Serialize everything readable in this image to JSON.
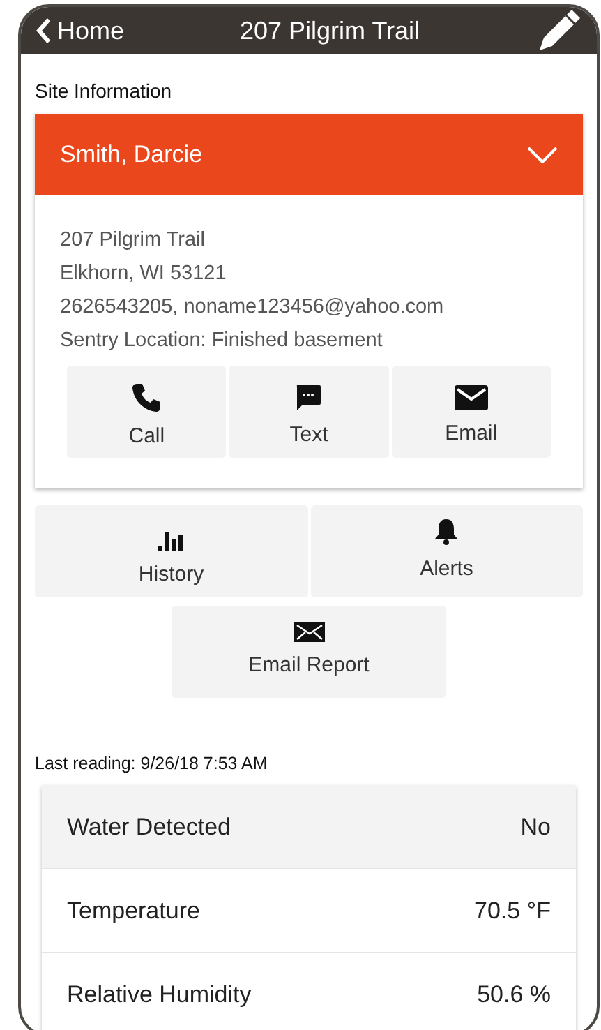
{
  "header": {
    "back_label": "Home",
    "title": "207 Pilgrim Trail"
  },
  "section_label": "Site Information",
  "contact": {
    "name": "Smith, Darcie",
    "expanded": true,
    "lines": [
      "207 Pilgrim Trail",
      "Elkhorn, WI 53121",
      "2626543205, noname123456@yahoo.com",
      "Sentry Location: Finished basement"
    ],
    "actions": [
      {
        "kind": "call",
        "label": "Call"
      },
      {
        "kind": "text",
        "label": "Text"
      },
      {
        "kind": "email",
        "label": "Email"
      }
    ]
  },
  "site_actions": [
    {
      "kind": "history",
      "label": "History"
    },
    {
      "kind": "alerts",
      "label": "Alerts"
    }
  ],
  "report_action": {
    "kind": "report",
    "label": "Email Report"
  },
  "last_reading": "Last reading: 9/26/18 7:53 AM",
  "readings": [
    {
      "name": "Water Detected",
      "value": "No",
      "selected": true
    },
    {
      "name": "Temperature",
      "value": "70.5 °F",
      "selected": false
    },
    {
      "name": "Relative Humidity",
      "value": "50.6 %",
      "selected": false
    }
  ]
}
